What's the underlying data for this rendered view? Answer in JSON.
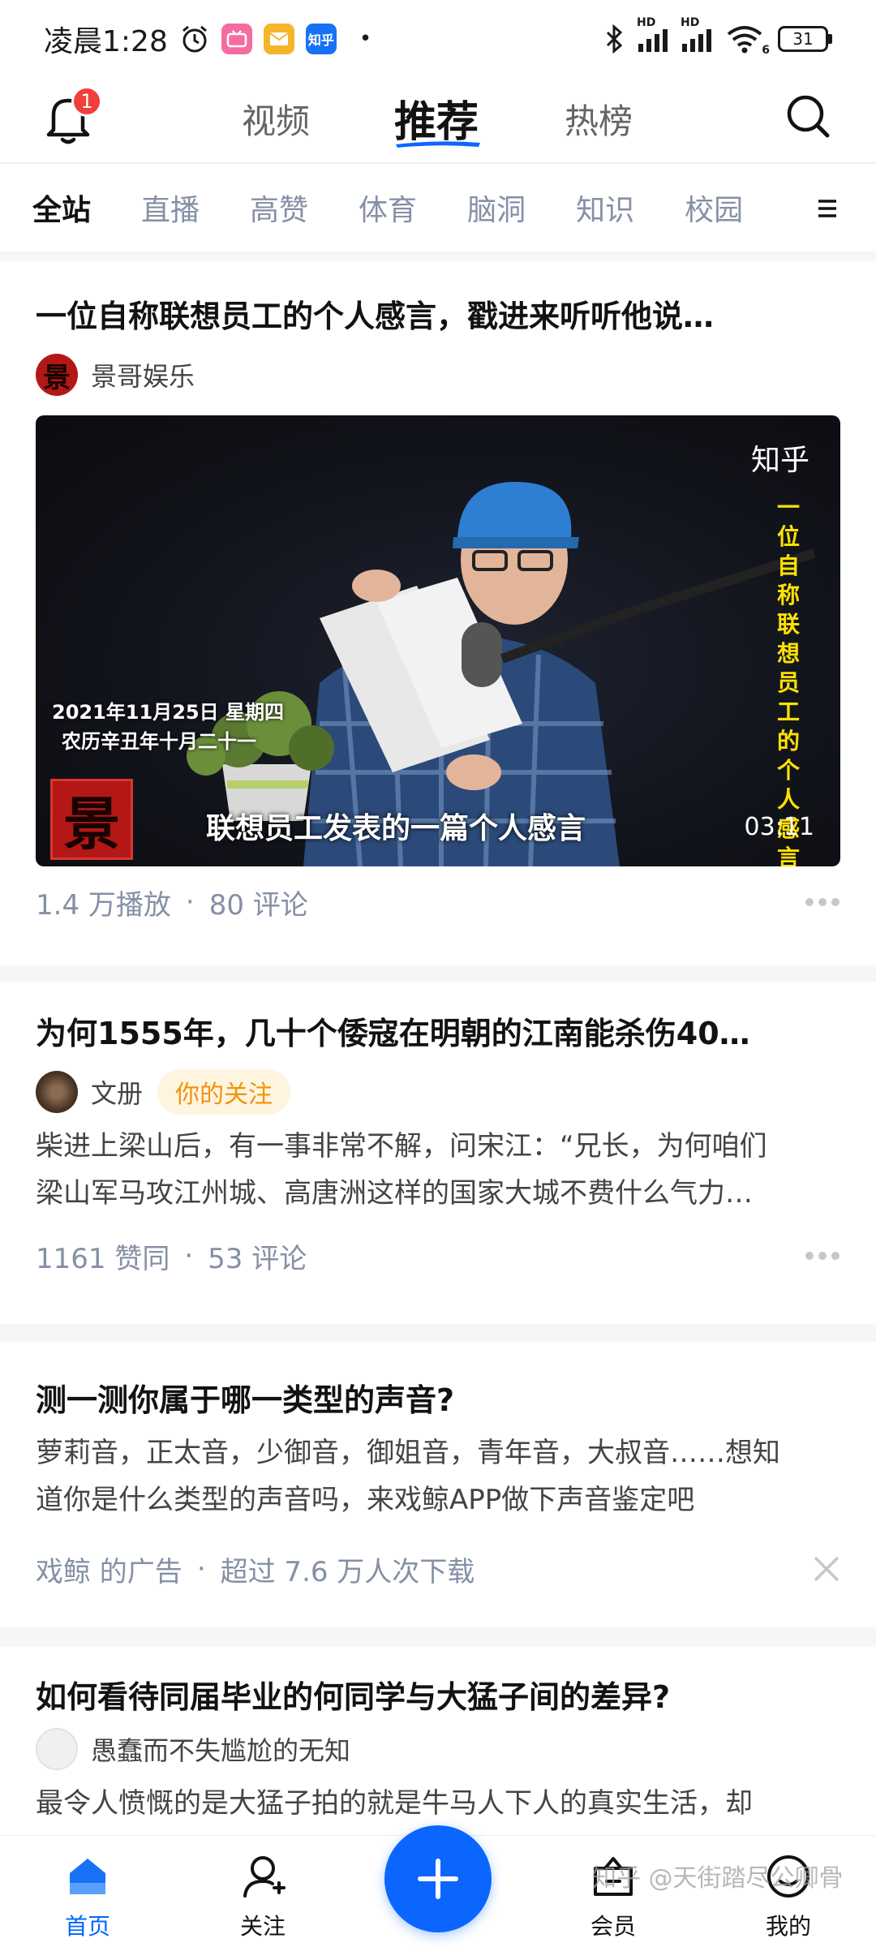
{
  "status_bar": {
    "time": "凌晨1:28",
    "app_icons": [
      "alarm-icon",
      "bilibili-icon",
      "mail-app-icon",
      "zhihu-app-icon"
    ],
    "app_icon_zhihu_label": "知乎",
    "dot": "•",
    "hd_label": "HD",
    "wifi_label": "6",
    "battery": "31"
  },
  "top_nav": {
    "notification_count": "1",
    "tabs": [
      {
        "label": "视频",
        "active": false
      },
      {
        "label": "推荐",
        "active": true
      },
      {
        "label": "热榜",
        "active": false
      }
    ]
  },
  "category_tabs": [
    {
      "label": "全站",
      "active": true
    },
    {
      "label": "直播",
      "active": false
    },
    {
      "label": "高赞",
      "active": false
    },
    {
      "label": "体育",
      "active": false
    },
    {
      "label": "脑洞",
      "active": false
    },
    {
      "label": "知识",
      "active": false
    },
    {
      "label": "校园",
      "active": false
    }
  ],
  "feed": [
    {
      "type": "video",
      "title": "一位自称联想员工的个人感言，戳进来听听他说…",
      "author": "景哥娱乐",
      "video": {
        "watermark": "知乎",
        "vertical_text": "一位自称联想员工的个人感言",
        "date_line1": "2021年11月25日 星期四",
        "date_line2": "农历辛丑年十月二十一",
        "caption": "联想员工发表的一篇个人感言",
        "duration": "03:11",
        "logo_char": "景"
      },
      "views": "1.4 万播放",
      "comments": "80 评论"
    },
    {
      "type": "article",
      "title": "为何1555年，几十个倭寇在明朝的江南能杀伤40…",
      "author": "文册",
      "badge": "你的关注",
      "excerpt_line1": "柴进上梁山后，有一事非常不解，问宋江：“兄长，为何咱们",
      "excerpt_line2": "梁山军马攻江州城、高唐洲这样的国家大城不费什么气力…",
      "likes": "1161 赞同",
      "comments": "53 评论"
    },
    {
      "type": "ad",
      "title": "测一测你属于哪一类型的声音?",
      "excerpt_line1": "萝莉音，正太音，少御音，御姐音，青年音，大叔音……想知",
      "excerpt_line2": "道你是什么类型的声音吗，来戏鲸APP做下声音鉴定吧",
      "advertiser": "戏鲸 的广告",
      "downloads": "超过 7.6 万人次下载"
    },
    {
      "type": "article",
      "title": "如何看待同届毕业的何同学与大猛子间的差异?",
      "author": "愚蠢而不失尴尬的无知",
      "excerpt_line1": "最令人愤慨的是大猛子拍的就是牛马人下人的真实生活，却"
    }
  ],
  "bottom_nav": {
    "items": [
      {
        "label": "首页",
        "active": true
      },
      {
        "label": "关注",
        "active": false
      },
      {
        "label": "会员",
        "active": false
      },
      {
        "label": "我的",
        "active": false
      }
    ]
  },
  "watermark": "知乎 @天街踏尽公卿骨",
  "colors": {
    "accent": "#0066ff",
    "badge_red": "#f1403c",
    "follow_orange": "#f0930a",
    "meta_gray": "#8590a6",
    "video_yellow_text": "#ffe100"
  }
}
